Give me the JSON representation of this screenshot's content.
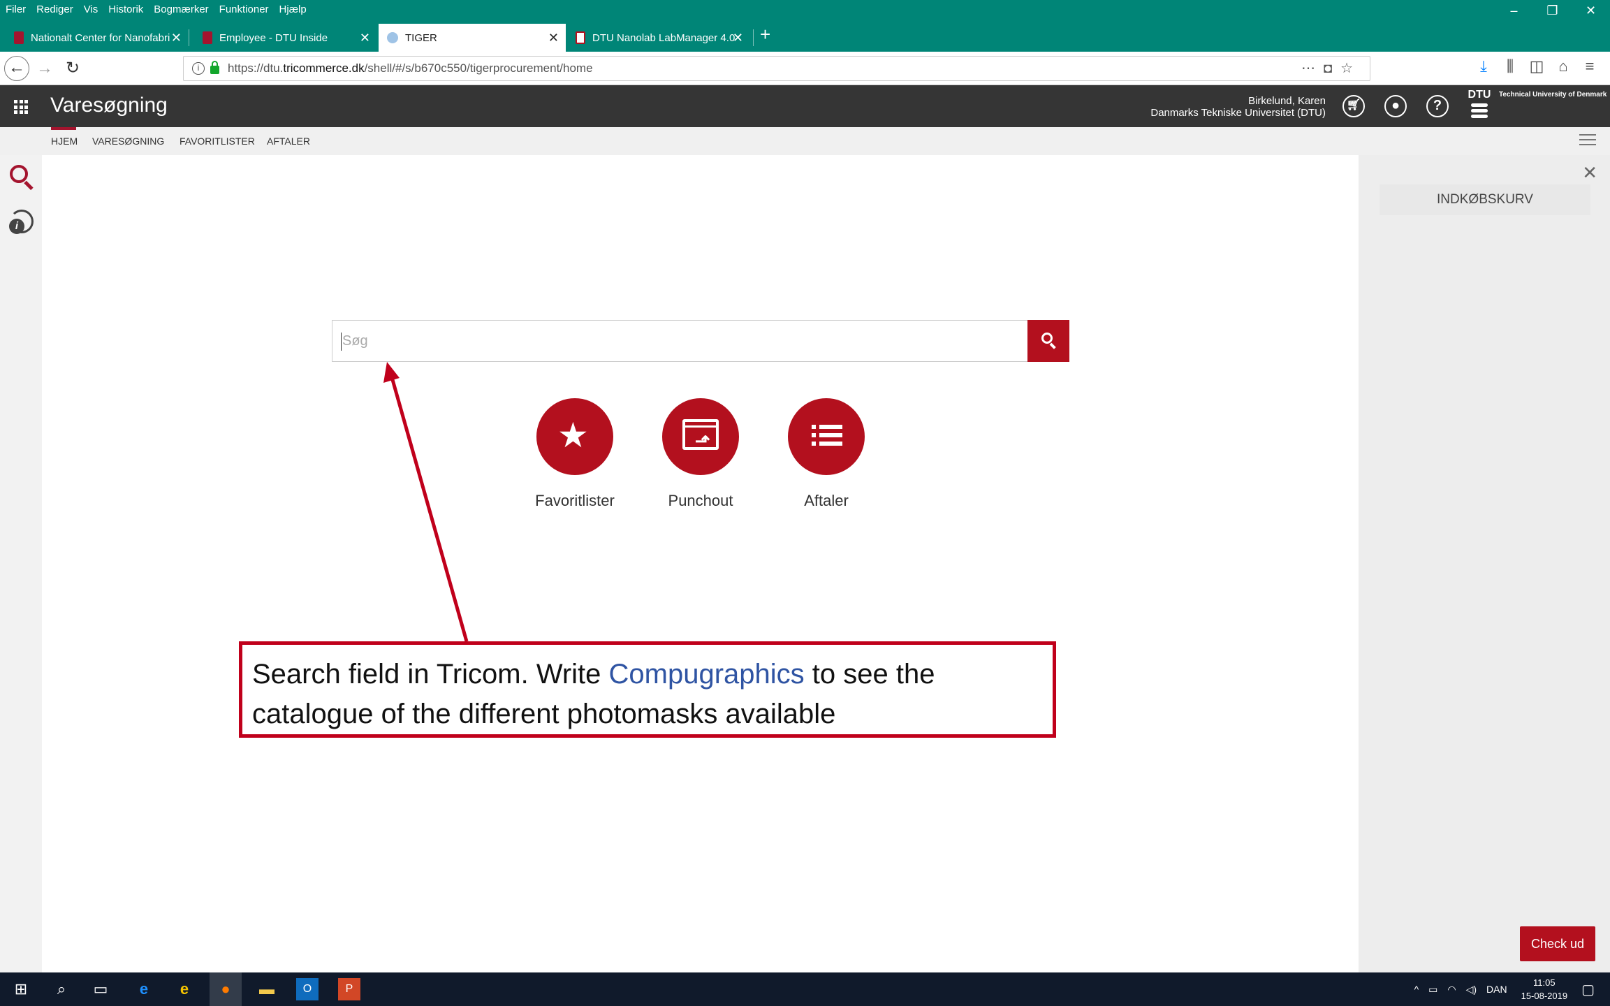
{
  "browser": {
    "menu": [
      "Filer",
      "Rediger",
      "Vis",
      "Historik",
      "Bogmærker",
      "Funktioner",
      "Hjælp"
    ],
    "tabs": [
      {
        "label": "Nationalt Center for Nanofabri"
      },
      {
        "label": "Employee - DTU Inside"
      },
      {
        "label": "TIGER"
      },
      {
        "label": "DTU Nanolab LabManager 4.0"
      }
    ],
    "url_prefix": "https://dtu.",
    "url_domain": "tricommerce.dk",
    "url_path": "/shell/#/s/b670c550/tigerprocurement/home"
  },
  "app": {
    "title": "Varesøgning",
    "user_name": "Birkelund, Karen",
    "user_org": "Danmarks Tekniske Universitet (DTU)",
    "logo_text": "DTU",
    "logo_subtitle": "Technical University of Denmark",
    "nav": [
      "HJEM",
      "VARESØGNING",
      "FAVORITLISTER",
      "AFTALER"
    ]
  },
  "search": {
    "placeholder": "Søg"
  },
  "actions": [
    {
      "label": "Favoritlister",
      "icon": "star-icon"
    },
    {
      "label": "Punchout",
      "icon": "punchout-icon"
    },
    {
      "label": "Aftaler",
      "icon": "list-icon"
    }
  ],
  "cart": {
    "title": "INDKØBSKURV",
    "checkout_label": "Check ud"
  },
  "annotation": {
    "text_before": "Search field in Tricom. Write ",
    "highlight": "Compugraphics",
    "text_after": " to see the catalogue of the different photomasks available",
    "highlight_color": "#2f54a3",
    "border_color": "#c0001b"
  },
  "taskbar": {
    "language": "DAN",
    "time": "11:05",
    "date": "15-08-2019"
  },
  "colors": {
    "brand_red": "#b3101e",
    "browser_teal": "#008577",
    "header_dark": "#353535"
  }
}
